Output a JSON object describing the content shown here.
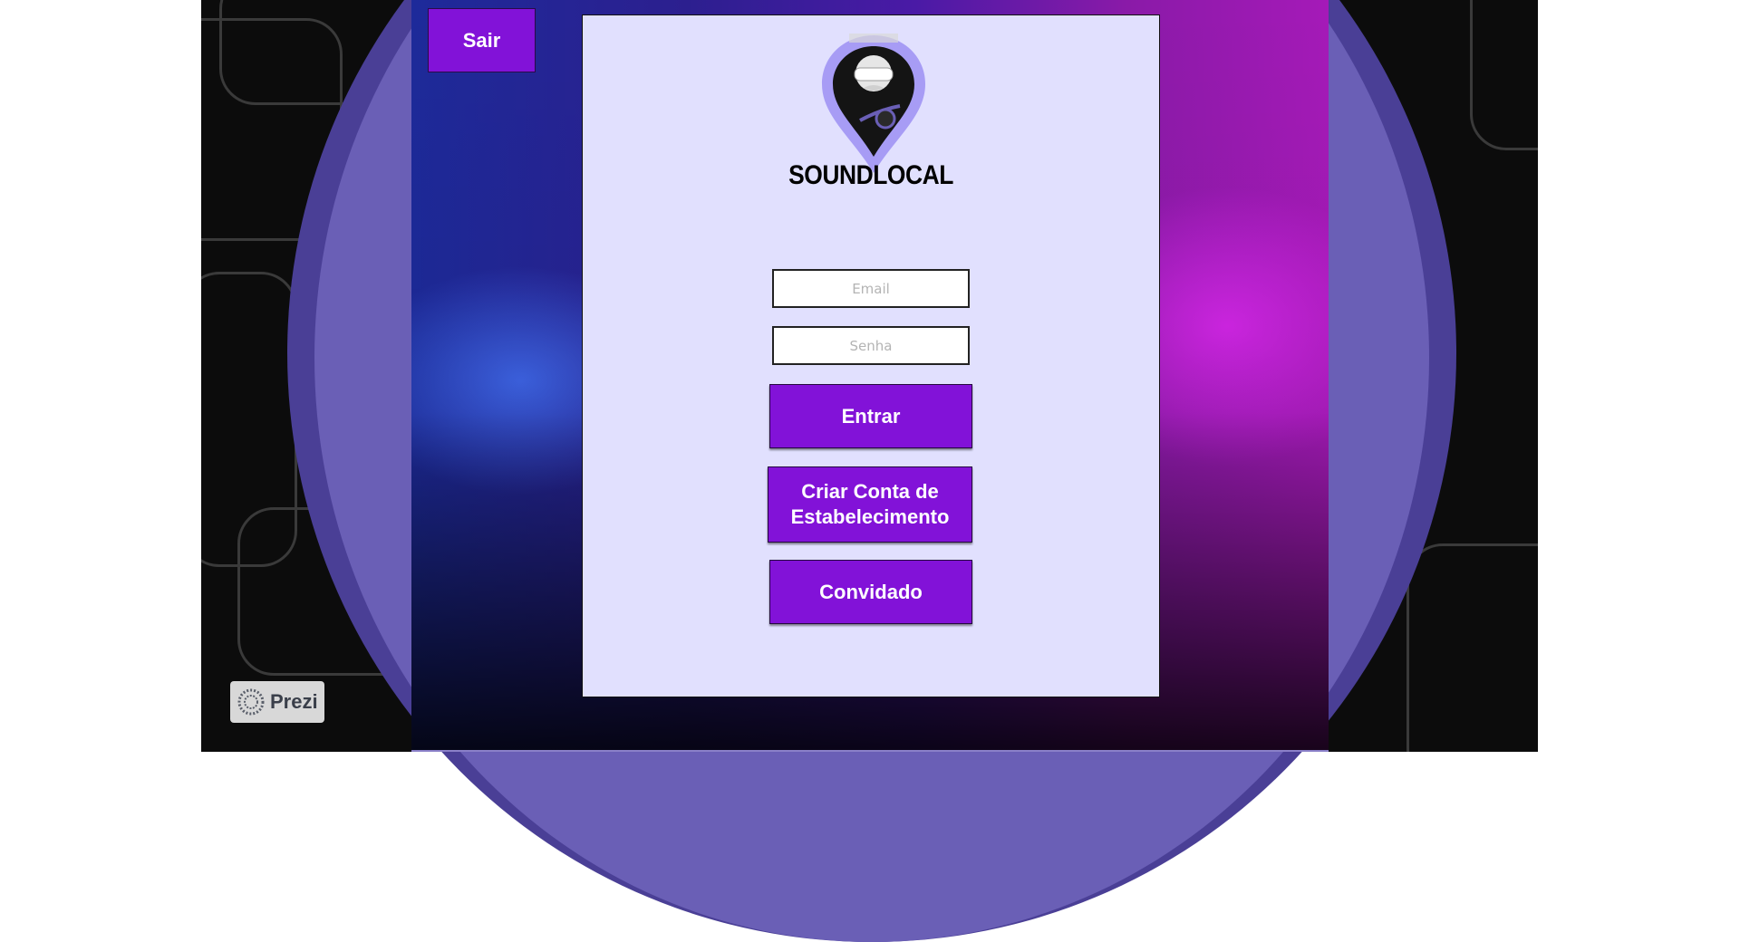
{
  "nav": {
    "exit_label": "Sair"
  },
  "brand": {
    "name": "SOUNDLOCAL"
  },
  "login": {
    "email_placeholder": "Email",
    "password_placeholder": "Senha",
    "enter_label": "Entrar",
    "create_account_label": "Criar Conta de Estabelecimento",
    "guest_label": "Convidado"
  },
  "footer": {
    "badge_label": "Prezi",
    "badge_icon": "prezi-logo-icon"
  },
  "colors": {
    "button": "#8212d8",
    "panel": "#e1e0fe",
    "oval_outer": "#4a3f96",
    "oval_inner": "#6a5fb6"
  }
}
